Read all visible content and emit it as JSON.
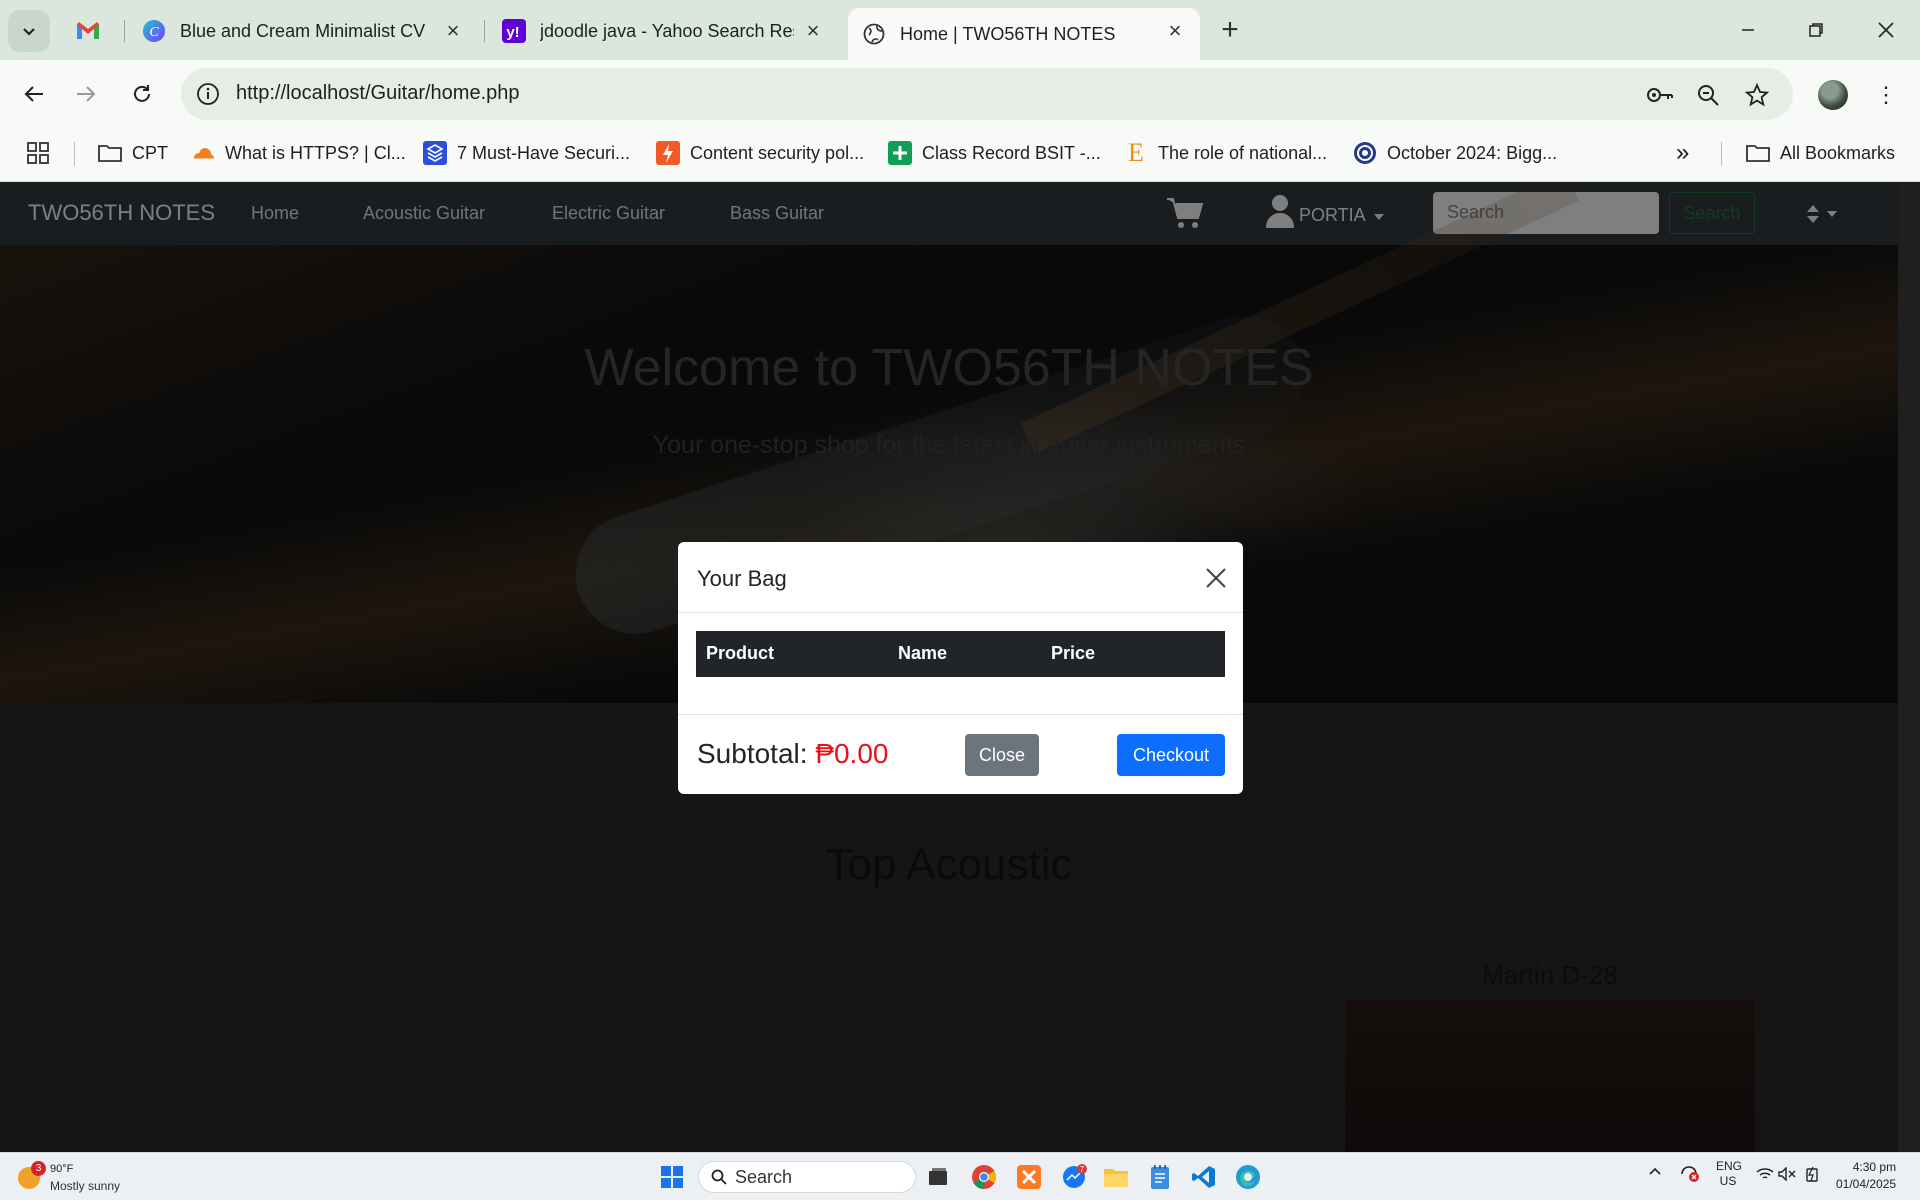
{
  "browser": {
    "tabs": [
      {
        "title": "",
        "icon": "gmail-icon"
      },
      {
        "title": "Blue and Cream Minimalist CV R",
        "icon": "canva-icon"
      },
      {
        "title": "jdoodle java - Yahoo Search Res",
        "icon": "yahoo-icon"
      },
      {
        "title": "Home | TWO56TH NOTES",
        "icon": "globe-icon"
      }
    ],
    "url": "http://localhost/Guitar/home.php",
    "bookmarks": [
      {
        "label": "CPT",
        "icon": "folder-icon"
      },
      {
        "label": "What is HTTPS? | Cl...",
        "icon": "cloudflare-icon"
      },
      {
        "label": "7 Must-Have Securi...",
        "icon": "layers-icon"
      },
      {
        "label": "Content security pol...",
        "icon": "bookmark-app-icon"
      },
      {
        "label": "Class Record BSIT -...",
        "icon": "sheets-icon"
      },
      {
        "label": "The role of national...",
        "icon": "letter-e-icon"
      },
      {
        "label": "October 2024: Bigg...",
        "icon": "circle-logo-icon"
      }
    ],
    "all_bookmarks": "All Bookmarks"
  },
  "site": {
    "brand": "TWO56TH NOTES",
    "nav": [
      "Home",
      "Acoustic Guitar",
      "Electric Guitar",
      "Bass Guitar"
    ],
    "user": "PORTIA",
    "search_placeholder": "Search",
    "search_button": "Search",
    "hero_title": "Welcome to TWO56TH NOTES",
    "hero_subtitle": "Your one-stop shop for the latest in guitar instruments",
    "section_title": "Top Acoustic",
    "product_name": "Martin D-28"
  },
  "modal": {
    "title": "Your Bag",
    "columns": [
      "Product",
      "Name",
      "Price"
    ],
    "subtotal_label": "Subtotal:",
    "subtotal_value": "₱0.00",
    "close_label": "Close",
    "checkout_label": "Checkout"
  },
  "taskbar": {
    "weather_badge": "3",
    "temperature": "90°F",
    "condition": "Mostly sunny",
    "search_label": "Search",
    "messenger_badge": "7",
    "lang_1": "ENG",
    "lang_2": "US",
    "time": "4:30 pm",
    "date": "01/04/2025"
  },
  "colors": {
    "accent": "#0d6efd",
    "price": "#e8111b",
    "navbar": "#343a40"
  }
}
